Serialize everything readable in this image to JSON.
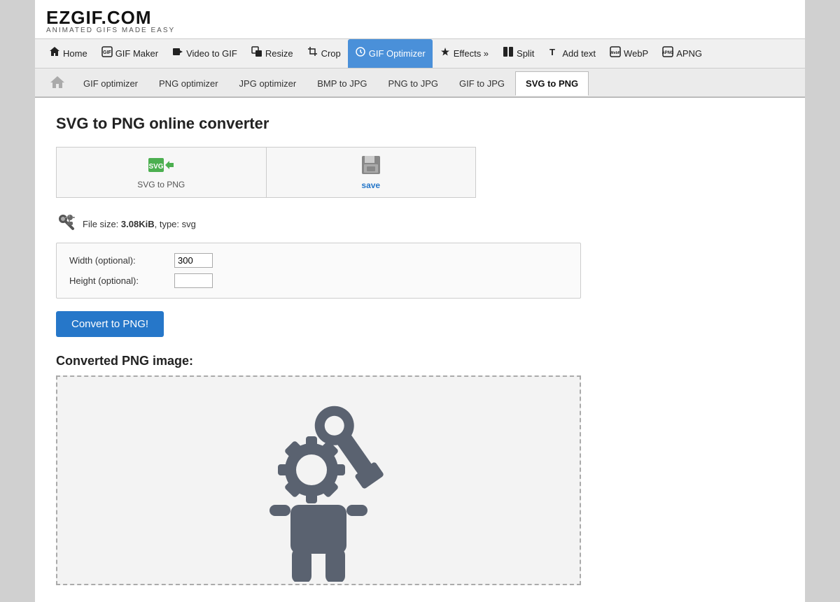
{
  "logo": {
    "title": "EZGIF.COM",
    "subtitle": "ANIMATED GIFS MADE EASY"
  },
  "nav": {
    "items": [
      {
        "id": "home",
        "label": "Home",
        "icon": "🏠",
        "active": false
      },
      {
        "id": "gif-maker",
        "label": "GIF Maker",
        "icon": "🖼",
        "active": false
      },
      {
        "id": "video-to-gif",
        "label": "Video to GIF",
        "icon": "🎬",
        "active": false
      },
      {
        "id": "resize",
        "label": "Resize",
        "icon": "⊡",
        "active": false
      },
      {
        "id": "crop",
        "label": "Crop",
        "icon": "✂",
        "active": false
      },
      {
        "id": "gif-optimizer",
        "label": "GIF Optimizer",
        "icon": "⚙",
        "active": true
      },
      {
        "id": "effects",
        "label": "Effects »",
        "icon": "✨",
        "active": false
      },
      {
        "id": "split",
        "label": "Split",
        "icon": "⧉",
        "active": false
      },
      {
        "id": "add-text",
        "label": "Add text",
        "icon": "T",
        "active": false
      },
      {
        "id": "webp",
        "label": "WebP",
        "icon": "🖼",
        "active": false
      },
      {
        "id": "apng",
        "label": "APNG",
        "icon": "🖼",
        "active": false
      }
    ]
  },
  "subnav": {
    "tabs": [
      {
        "id": "gif-optimizer",
        "label": "GIF optimizer",
        "active": false
      },
      {
        "id": "png-optimizer",
        "label": "PNG optimizer",
        "active": false
      },
      {
        "id": "jpg-optimizer",
        "label": "JPG optimizer",
        "active": false
      },
      {
        "id": "bmp-to-jpg",
        "label": "BMP to JPG",
        "active": false
      },
      {
        "id": "png-to-jpg",
        "label": "PNG to JPG",
        "active": false
      },
      {
        "id": "gif-to-jpg",
        "label": "GIF to JPG",
        "active": false
      },
      {
        "id": "svg-to-png",
        "label": "SVG to PNG",
        "active": true
      }
    ]
  },
  "page": {
    "title": "SVG to PNG online converter"
  },
  "action_tabs": {
    "svg_to_png_label": "SVG to PNG",
    "save_label": "save"
  },
  "file_info": {
    "size": "3.08KiB",
    "type": "svg",
    "prefix": "File size: ",
    "type_prefix": ", type: "
  },
  "options": {
    "width_label": "Width (optional):",
    "width_value": "300",
    "height_label": "Height (optional):",
    "height_value": ""
  },
  "convert_button": {
    "label": "Convert to PNG!"
  },
  "converted": {
    "label": "Converted PNG image:"
  }
}
